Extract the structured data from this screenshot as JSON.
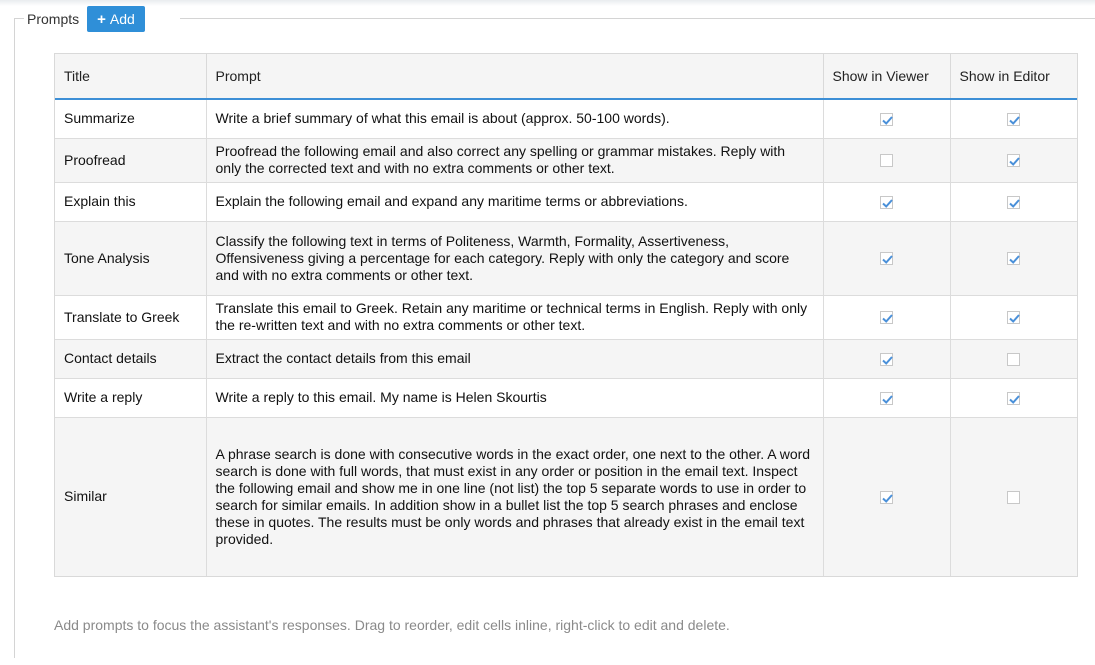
{
  "section": {
    "legend": "Prompts",
    "add_button": "Add",
    "add_icon": "plus-icon"
  },
  "columns": [
    "Title",
    "Prompt",
    "Show in Viewer",
    "Show in Editor"
  ],
  "rows": [
    {
      "title": "Summarize",
      "prompt": "Write a brief summary of what this email is about (approx. 50-100 words).",
      "viewer": true,
      "editor": true
    },
    {
      "title": "Proofread",
      "prompt": "Proofread the following email and also correct any spelling or grammar mistakes. Reply with only the corrected text and with no extra comments or other text.",
      "viewer": false,
      "editor": true
    },
    {
      "title": "Explain this",
      "prompt": "Explain the following email and expand any maritime terms or abbreviations.",
      "viewer": true,
      "editor": true
    },
    {
      "title": "Tone Analysis",
      "prompt": "Classify the following text in terms of Politeness, Warmth, Formality, Assertiveness, Offensiveness giving a percentage for each category. Reply with only the category and score and with no extra comments or other text.",
      "viewer": true,
      "editor": true
    },
    {
      "title": "Translate to Greek",
      "prompt": "Translate this email to Greek. Retain any maritime or technical terms in English. Reply with only the re-written text and with no extra comments or other text.",
      "viewer": true,
      "editor": true
    },
    {
      "title": "Contact details",
      "prompt": "Extract the contact details from this email",
      "viewer": true,
      "editor": false
    },
    {
      "title": "Write a reply",
      "prompt": "Write a reply to this email. My name is Helen Skourtis",
      "viewer": true,
      "editor": true
    },
    {
      "title": "Similar",
      "prompt": "A phrase search is done with consecutive words in the exact order, one next to the other. A word search is done with full words, that must exist in any order or position in the email text. Inspect the following email and show me in one line (not list) the top 5 separate words to use in order to search for similar emails. In addition show in a bullet list the top 5 search phrases and enclose these in quotes. The results must be only words and phrases that already exist in the email text provided.",
      "viewer": true,
      "editor": false
    }
  ],
  "footer_hint": "Add prompts to focus the assistant's responses. Drag to reorder, edit cells inline, right-click to edit and delete.",
  "colors": {
    "accent": "#2f8fd8",
    "checkmark": "#4a90d9",
    "header_border": "#3d8fd6"
  }
}
